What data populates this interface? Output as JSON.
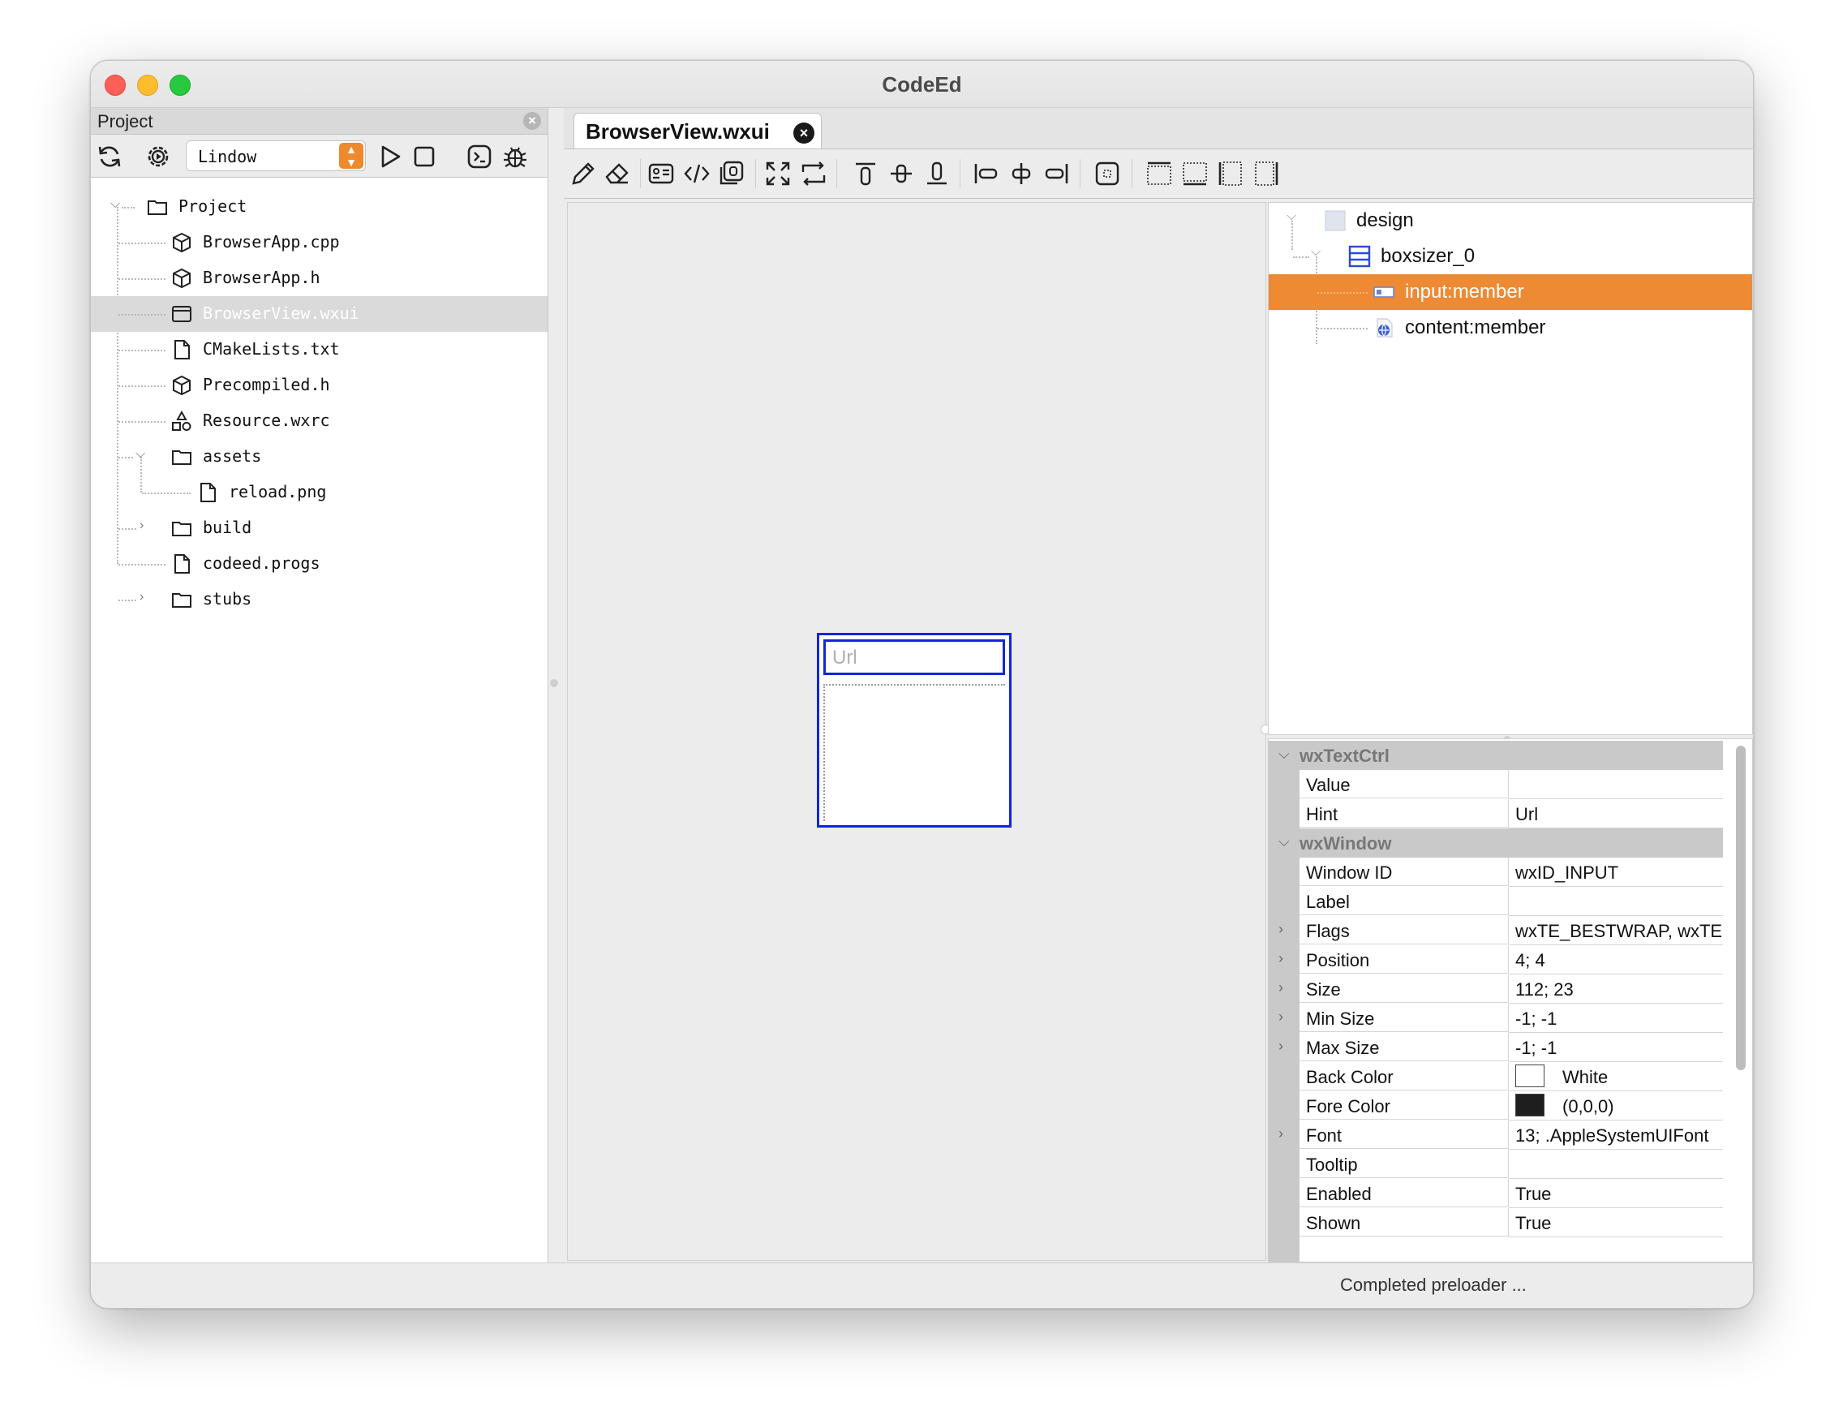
{
  "window": {
    "title": "CodeEd"
  },
  "project_panel": {
    "title": "Project",
    "target_combo": {
      "value": "Lindow"
    },
    "icons": [
      "refresh-icon",
      "settings-icon",
      "play-icon",
      "stop-icon",
      "terminal-icon",
      "debug-icon"
    ],
    "tree": [
      {
        "label": "Project",
        "icon": "folder",
        "depth": 0,
        "expanded": true
      },
      {
        "label": "BrowserApp.cpp",
        "icon": "cube",
        "depth": 1
      },
      {
        "label": "BrowserApp.h",
        "icon": "cube",
        "depth": 1
      },
      {
        "label": "BrowserView.wxui",
        "icon": "window",
        "depth": 1,
        "selected": true
      },
      {
        "label": "CMakeLists.txt",
        "icon": "file",
        "depth": 1
      },
      {
        "label": "Precompiled.h",
        "icon": "cube",
        "depth": 1
      },
      {
        "label": "Resource.wxrc",
        "icon": "shapes",
        "depth": 1
      },
      {
        "label": "assets",
        "icon": "folder",
        "depth": 1,
        "expanded": true
      },
      {
        "label": "reload.png",
        "icon": "file",
        "depth": 2
      },
      {
        "label": "build",
        "icon": "folder",
        "depth": 1,
        "collapsed": true
      },
      {
        "label": "codeed.progs",
        "icon": "file",
        "depth": 1
      },
      {
        "label": "stubs",
        "icon": "folder",
        "depth": 1,
        "collapsed": true
      }
    ]
  },
  "editor": {
    "tab": {
      "label": "BrowserView.wxui"
    },
    "canvas": {
      "input_placeholder": "Url"
    }
  },
  "object_tree": [
    {
      "label": "design",
      "depth": 0
    },
    {
      "label": "boxsizer_0",
      "depth": 1
    },
    {
      "label": "input:member",
      "depth": 2,
      "selected": true
    },
    {
      "label": "content:member",
      "depth": 2
    }
  ],
  "properties": [
    {
      "category": "wxTextCtrl"
    },
    {
      "name": "Value",
      "value": ""
    },
    {
      "name": "Hint",
      "value": "Url"
    },
    {
      "category": "wxWindow"
    },
    {
      "name": "Window ID",
      "value": "wxID_INPUT"
    },
    {
      "name": "Label",
      "value": ""
    },
    {
      "name": "Flags",
      "value": "wxTE_BESTWRAP, wxTE",
      "expandable": true
    },
    {
      "name": "Position",
      "value": "4; 4",
      "expandable": true
    },
    {
      "name": "Size",
      "value": "112; 23",
      "expandable": true
    },
    {
      "name": "Min Size",
      "value": "-1; -1",
      "expandable": true
    },
    {
      "name": "Max Size",
      "value": "-1; -1",
      "expandable": true
    },
    {
      "name": "Back Color",
      "value": "White",
      "swatch": "#ffffff"
    },
    {
      "name": "Fore Color",
      "value": "(0,0,0)",
      "swatch": "#1e1e1e"
    },
    {
      "name": "Font",
      "value": "13; .AppleSystemUIFont",
      "expandable": true
    },
    {
      "name": "Tooltip",
      "value": ""
    },
    {
      "name": "Enabled",
      "value": "True"
    },
    {
      "name": "Shown",
      "value": "True"
    }
  ],
  "status": {
    "message": "Completed preloader ..."
  },
  "colors": {
    "accent": "#ee8a33",
    "selection_outline": "#1424e0"
  }
}
